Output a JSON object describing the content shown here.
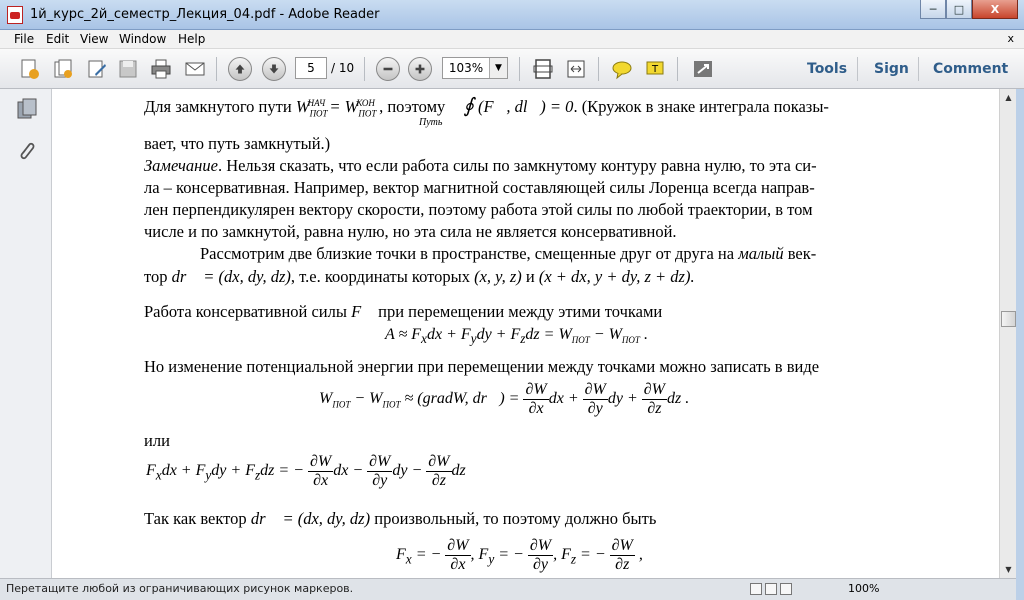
{
  "window": {
    "title": "1й_курс_2й_семестр_Лекция_04.pdf - Adobe Reader",
    "minimize": "0",
    "maximize": "1",
    "close": "X"
  },
  "menu": {
    "items": [
      "File",
      "Edit",
      "View",
      "Window",
      "Help"
    ],
    "close": "x"
  },
  "toolbar": {
    "page_current": "5",
    "page_total": "/ 10",
    "zoom": "103%",
    "tools": "Tools",
    "sign": "Sign",
    "comment": "Comment"
  },
  "doc": {
    "l1a": "Для замкнутого пути",
    "l1b": ", поэтому",
    "l1c": ". (Кружок в знаке интеграла показы-",
    "l1_sub": "Путь",
    "l2": "вает, что путь замкнутый.)",
    "l3a": "Замечание",
    "l3b": ". Нельзя сказать, что если работа силы по замкнутому контуру равна нулю, то эта си-",
    "l4": "ла – консервативная. Например, вектор магнитной составляющей силы Лоренца всегда направ-",
    "l5": "лен перпендикулярен вектору скорости, поэтому работа этой силы по любой траектории, в том",
    "l6": "числе и по замкнутой, равна нулю, но эта сила не является консервативной.",
    "l7a": "Рассмотрим две близкие точки в пространстве, смещенные друг от друга на",
    "l7b": "малый",
    "l7c": "век-",
    "l8a": "тор",
    "l8b": ", т.е. координаты которых",
    "l8c": "и",
    "l9a": "Работа консервативной силы",
    "l9b": "при перемещении между этими точками",
    "l11": "Но изменение потенциальной энергии при перемещении между точками можно записать в виде",
    "l13": "или",
    "l15a": "Так как вектор",
    "l15b": "произвольный, то поэтому должно быть",
    "sub_nach": "НАЧ",
    "sub_kon": "КОН",
    "sub_pot": "ПОТ"
  },
  "status": {
    "text": "Перетащите любой из ограничивающих рисунок маркеров.",
    "zoom": "100%"
  }
}
